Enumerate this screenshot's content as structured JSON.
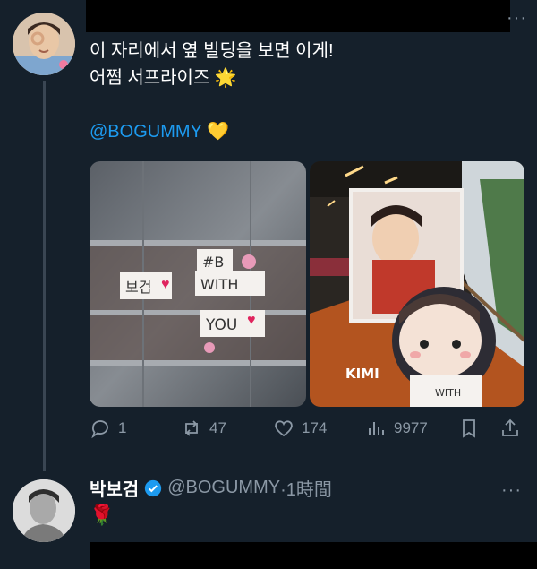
{
  "tweet": {
    "text_line1": "이 자리에서 옆 빌딩을 보면 이게!",
    "text_line2": "어쩜 서프라이즈",
    "emoji_star": "🌟",
    "mention": "@BOGUMMY",
    "emoji_heart": "💛",
    "photo_left": {
      "note1": "보검",
      "note2_line1": "#B",
      "note2_line2": "WITH",
      "note3": "YOU"
    },
    "photo_right": {
      "doll_label": "KIMI",
      "shirt_text": "WITH"
    },
    "actions": {
      "replies": "1",
      "retweets": "47",
      "likes": "174",
      "views": "9977"
    }
  },
  "reply": {
    "name": "박보검",
    "handle": "@BOGUMMY",
    "time": "·1時間",
    "body_emoji": "🌹"
  },
  "colors": {
    "background": "#15202b",
    "accent": "#1d9bf0",
    "secondary_text": "#8b98a5"
  }
}
